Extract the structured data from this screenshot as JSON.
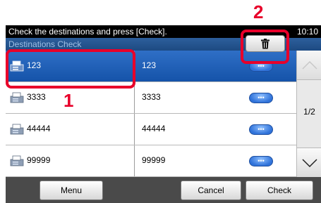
{
  "status": {
    "message": "Check the destinations and press [Check].",
    "time": "10:10"
  },
  "title": "Destinations Check",
  "rows": [
    {
      "name": "123",
      "address": "123"
    },
    {
      "name": "3333",
      "address": "3333"
    },
    {
      "name": "44444",
      "address": "44444"
    },
    {
      "name": "99999",
      "address": "99999"
    }
  ],
  "scroll": {
    "page": "1/2"
  },
  "footer": {
    "menu": "Menu",
    "cancel": "Cancel",
    "check": "Check"
  },
  "callouts": {
    "first": "1",
    "second": "2"
  },
  "colors": {
    "selected": "#1553a9",
    "callout": "#e8002a",
    "statusbar": "#000000"
  },
  "icons": {
    "delete": "trash-icon",
    "destination": "fax-icon",
    "details": "more-icon",
    "up": "chevron-up-icon",
    "down": "chevron-down-icon"
  }
}
